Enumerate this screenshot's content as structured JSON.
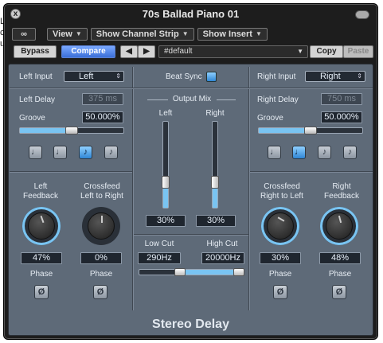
{
  "background_text": [
    "Lu",
    "ck",
    "um"
  ],
  "window": {
    "title": "70s Ballad Piano 01",
    "close_glyph": "x"
  },
  "toolbar": {
    "link_glyph": "∞",
    "view": "View",
    "show_channel_strip": "Show Channel Strip",
    "show_insert": "Show Insert"
  },
  "controls": {
    "bypass": "Bypass",
    "compare": "Compare",
    "prev": "◀",
    "next": "▶",
    "preset": "#default",
    "copy": "Copy",
    "paste": "Paste"
  },
  "plugin": {
    "name": "Stereo Delay",
    "beat_sync": "Beat Sync",
    "output_mix": "Output Mix",
    "left": {
      "input_label": "Left Input",
      "input_value": "Left",
      "delay_label": "Left Delay",
      "delay_value": "375 ms",
      "groove_label": "Groove",
      "groove_value": "50.000%",
      "groove_level": 0.5,
      "feedback_label": "Left\nFeedback",
      "feedback_value": "47%",
      "crossfeed_label": "Crossfeed\nLeft to Right",
      "crossfeed_value": "0%",
      "phase_label": "Phase",
      "phase_label2": "Phase",
      "phase_glyph": "Ø"
    },
    "right": {
      "input_label": "Right Input",
      "input_value": "Right",
      "delay_label": "Right Delay",
      "delay_value": "750 ms",
      "groove_label": "Groove",
      "groove_value": "50.000%",
      "groove_level": 0.5,
      "crossfeed_label": "Crossfeed\nRight to Left",
      "crossfeed_value": "30%",
      "feedback_label": "Right\nFeedback",
      "feedback_value": "48%",
      "phase_label": "Phase",
      "phase_label2": "Phase",
      "phase_glyph": "Ø"
    },
    "output": {
      "left_label": "Left",
      "right_label": "Right",
      "left_value": "30%",
      "right_value": "30%",
      "left_level": 0.3,
      "right_level": 0.3
    },
    "filters": {
      "low_cut_label": "Low Cut",
      "high_cut_label": "High Cut",
      "low_cut_value": "290Hz",
      "high_cut_value": "20000Hz"
    },
    "note_glyphs": [
      "♩",
      "♩",
      "♪",
      "♪"
    ],
    "accent_color": "#79c4f2"
  }
}
